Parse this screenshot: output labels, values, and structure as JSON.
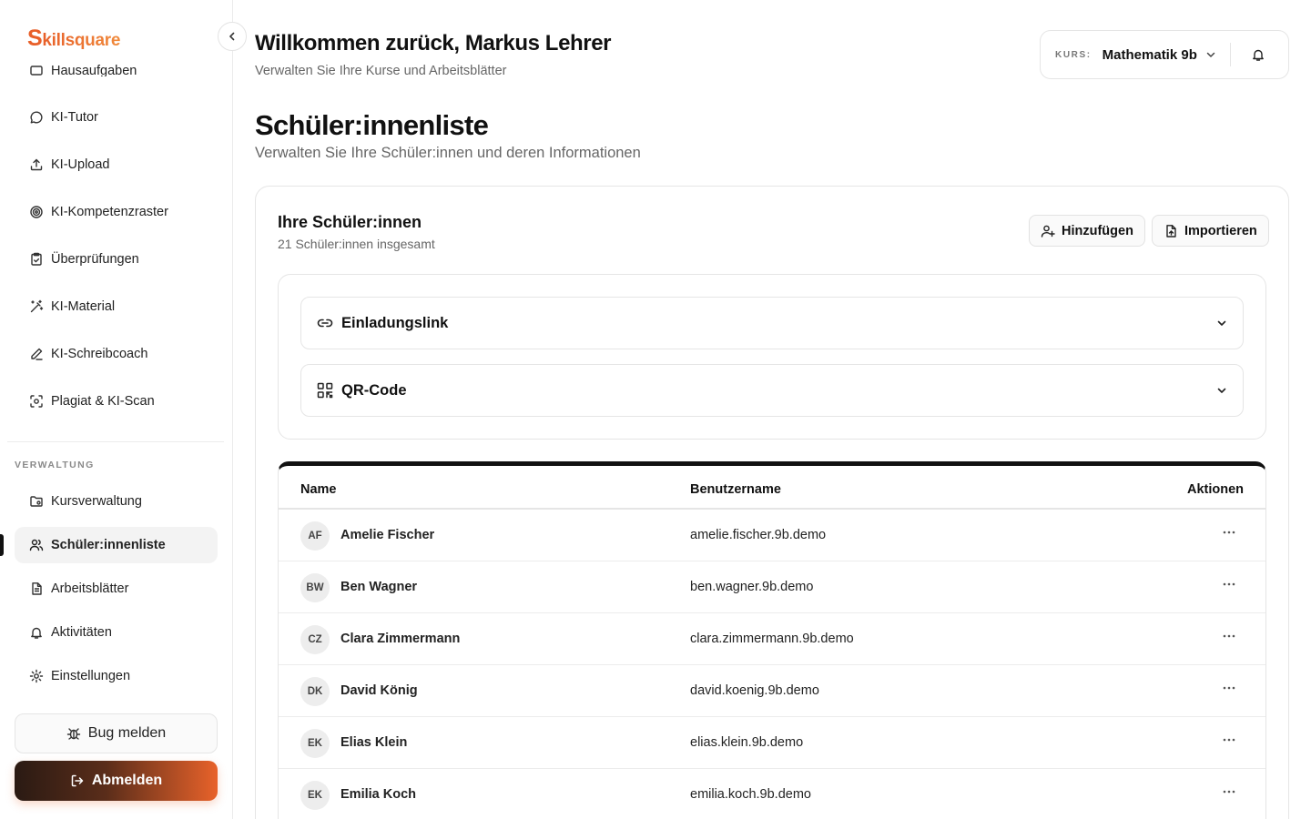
{
  "brand": {
    "logo_first": "S",
    "logo_rest": "killsquare"
  },
  "sidebar": {
    "partial_item": "Hausaufgaben",
    "items": [
      {
        "label": "KI-Tutor",
        "icon": "chat-bubble-icon"
      },
      {
        "label": "KI-Upload",
        "icon": "upload-icon"
      },
      {
        "label": "KI-Kompetenzraster",
        "icon": "target-icon"
      },
      {
        "label": "Überprüfungen",
        "icon": "clipboard-check-icon"
      },
      {
        "label": "KI-Material",
        "icon": "magic-wand-icon"
      },
      {
        "label": "KI-Schreibcoach",
        "icon": "pen-icon"
      },
      {
        "label": "Plagiat & KI-Scan",
        "icon": "scan-icon"
      }
    ],
    "section_label": "VERWALTUNG",
    "admin_items": [
      {
        "label": "Kursverwaltung",
        "icon": "folder-settings-icon"
      },
      {
        "label": "Schüler:innenliste",
        "icon": "users-icon",
        "active": true
      },
      {
        "label": "Arbeitsblätter",
        "icon": "document-icon"
      },
      {
        "label": "Aktivitäten",
        "icon": "bell-icon"
      },
      {
        "label": "Einstellungen",
        "icon": "gear-icon"
      }
    ],
    "bug_label": "Bug melden",
    "logout_label": "Abmelden"
  },
  "header": {
    "welcome": "Willkommen zurück, Markus Lehrer",
    "subtitle": "Verwalten Sie Ihre Kurse und Arbeitsblätter",
    "course_label": "KURS:",
    "course_value": "Mathematik 9b"
  },
  "page": {
    "title": "Schüler:innenliste",
    "subtitle": "Verwalten Sie Ihre Schüler:innen und deren Informationen"
  },
  "card": {
    "title": "Ihre Schüler:innen",
    "count_text": "21 Schüler:innen insgesamt",
    "add_label": "Hinzufügen",
    "import_label": "Importieren",
    "accordion_invite": "Einladungslink",
    "accordion_qr": "QR-Code"
  },
  "table": {
    "headers": {
      "name": "Name",
      "username": "Benutzername",
      "actions": "Aktionen"
    },
    "rows": [
      {
        "initials": "AF",
        "name": "Amelie Fischer",
        "username": "amelie.fischer.9b.demo"
      },
      {
        "initials": "BW",
        "name": "Ben Wagner",
        "username": "ben.wagner.9b.demo"
      },
      {
        "initials": "CZ",
        "name": "Clara Zimmermann",
        "username": "clara.zimmermann.9b.demo"
      },
      {
        "initials": "DK",
        "name": "David König",
        "username": "david.koenig.9b.demo"
      },
      {
        "initials": "EK",
        "name": "Elias Klein",
        "username": "elias.klein.9b.demo"
      },
      {
        "initials": "EK",
        "name": "Emilia Koch",
        "username": "emilia.koch.9b.demo"
      }
    ]
  },
  "colors": {
    "accent": "#e8602a",
    "active_bar": "#111111"
  }
}
